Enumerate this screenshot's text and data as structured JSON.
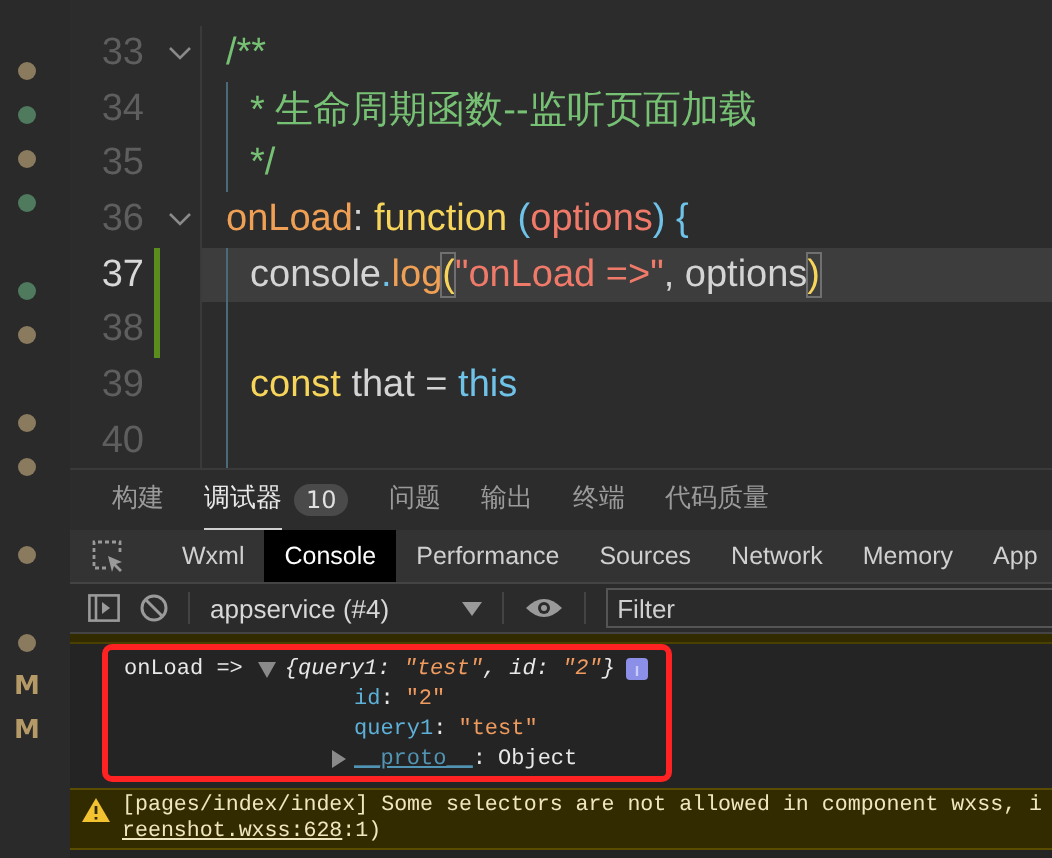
{
  "gutter_marks": [
    {
      "kind": "gap"
    },
    {
      "kind": "dot",
      "color": "#8a7a5e"
    },
    {
      "kind": "dot",
      "color": "#4f7a5e"
    },
    {
      "kind": "dot",
      "color": "#8a7a5e"
    },
    {
      "kind": "dot",
      "color": "#4f7a5e"
    },
    {
      "kind": "gap"
    },
    {
      "kind": "dot",
      "color": "#4f7a5e"
    },
    {
      "kind": "dot",
      "color": "#8a7a5e"
    },
    {
      "kind": "gap"
    },
    {
      "kind": "dot",
      "color": "#8a7a5e"
    },
    {
      "kind": "dot",
      "color": "#8a7a5e"
    },
    {
      "kind": "gap"
    },
    {
      "kind": "dot",
      "color": "#8a7a5e"
    },
    {
      "kind": "gap"
    },
    {
      "kind": "dot",
      "color": "#8a7a5e"
    },
    {
      "kind": "letter",
      "text": "M"
    },
    {
      "kind": "letter",
      "text": "M"
    }
  ],
  "editor": {
    "lines": [
      {
        "number": "33",
        "fold": true,
        "current": false,
        "changed": false,
        "guide": false,
        "tokens": [
          {
            "kind": "comment",
            "text": "/**"
          }
        ]
      },
      {
        "number": "34",
        "fold": false,
        "current": false,
        "changed": false,
        "guide": true,
        "tokens": [
          {
            "kind": "comment",
            "text": "* 生命周期函数--监听页面加载"
          }
        ]
      },
      {
        "number": "35",
        "fold": false,
        "current": false,
        "changed": false,
        "guide": true,
        "tokens": [
          {
            "kind": "comment",
            "text": "*/"
          }
        ]
      },
      {
        "number": "36",
        "fold": true,
        "current": false,
        "changed": false,
        "guide": false,
        "tokens": [
          {
            "kind": "property",
            "text": "onLoad"
          },
          {
            "kind": "plain",
            "text": ": "
          },
          {
            "kind": "keyword",
            "text": "function"
          },
          {
            "kind": "bracket",
            "text": " ("
          },
          {
            "kind": "param",
            "text": "options"
          },
          {
            "kind": "bracket",
            "text": ") {"
          }
        ]
      },
      {
        "number": "37",
        "fold": false,
        "current": true,
        "changed": true,
        "guide": true,
        "tokens": [
          {
            "kind": "plain",
            "text": "console"
          },
          {
            "kind": "bracket",
            "text": "."
          },
          {
            "kind": "property",
            "text": "log"
          },
          {
            "kind": "match",
            "text": "("
          },
          {
            "kind": "string",
            "text": "\"onLoad =>\""
          },
          {
            "kind": "plain",
            "text": ", options"
          },
          {
            "kind": "match",
            "text": ")"
          }
        ]
      },
      {
        "number": "38",
        "fold": false,
        "current": false,
        "changed": true,
        "guide": true
      },
      {
        "number": "39",
        "fold": false,
        "current": false,
        "changed": false,
        "guide": true,
        "tokens": [
          {
            "kind": "keyword",
            "text": "const"
          },
          {
            "kind": "plain",
            "text": " that = "
          },
          {
            "kind": "bracket",
            "text": "this"
          }
        ]
      },
      {
        "number": "40",
        "fold": false,
        "current": false,
        "changed": false,
        "guide": true
      }
    ]
  },
  "panel_tabs": [
    {
      "label": "构建",
      "selected": false
    },
    {
      "label": "调试器",
      "selected": true,
      "badge": "10"
    },
    {
      "label": "问题",
      "selected": false
    },
    {
      "label": "输出",
      "selected": false
    },
    {
      "label": "终端",
      "selected": false
    },
    {
      "label": "代码质量",
      "selected": false
    }
  ],
  "devtools_tabs": [
    {
      "label": "Wxml",
      "selected": false
    },
    {
      "label": "Console",
      "selected": true
    },
    {
      "label": "Performance",
      "selected": false
    },
    {
      "label": "Sources",
      "selected": false
    },
    {
      "label": "Network",
      "selected": false
    },
    {
      "label": "Memory",
      "selected": false
    },
    {
      "label": "App",
      "selected": false
    }
  ],
  "console_toolbar": {
    "context": "appservice (#4)",
    "filter": {
      "placeholder": "Filter"
    }
  },
  "console": {
    "entries": [
      {
        "kind": "log",
        "highlighted": true,
        "message": "onLoad =>",
        "expanded": true,
        "preview": [
          {
            "kind": "punct",
            "text": "{query1: "
          },
          {
            "kind": "string",
            "text": "\"test\""
          },
          {
            "kind": "punct",
            "text": ", id: "
          },
          {
            "kind": "string",
            "text": "\"2\""
          },
          {
            "kind": "punct",
            "text": "}"
          }
        ],
        "children": [
          {
            "key": "id",
            "colon": ":",
            "value": "\"2\"",
            "kind": "string"
          },
          {
            "key": "query1",
            "colon": ":",
            "value": "\"test\"",
            "kind": "string"
          },
          {
            "key": "__proto__",
            "colon": ":",
            "value": "Object",
            "kind": "proto",
            "expanded": false
          }
        ]
      },
      {
        "kind": "warning",
        "message": "[pages/index/index] Some selectors are not allowed in component wxss, i",
        "link": "reenshot.wxss:628",
        "tail": ":1)"
      }
    ]
  }
}
